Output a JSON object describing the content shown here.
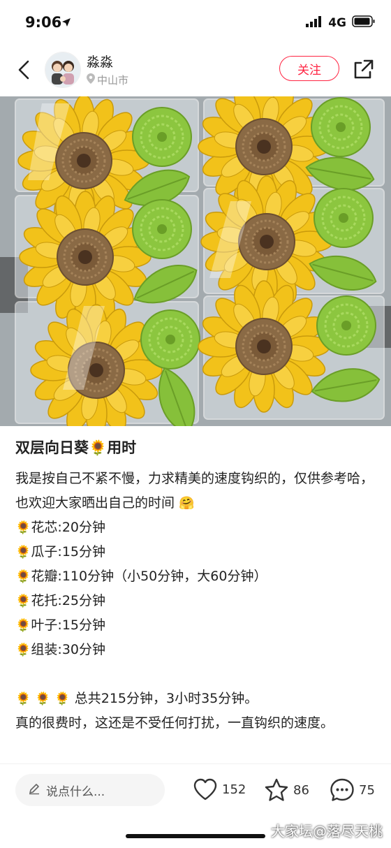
{
  "status_bar": {
    "time": "9:06",
    "network": "4G"
  },
  "header": {
    "user_name": "淼淼",
    "location": "中山市",
    "follow_label": "关注"
  },
  "post": {
    "title": "双层向日葵🌻用时",
    "intro": "我是按自己不紧不慢，力求精美的速度钩织的，仅供参考哈，也欢迎大家晒出自己的时间",
    "intro_emoji": "🤗",
    "items": [
      {
        "icon": "🌻",
        "text": "花芯:20分钟"
      },
      {
        "icon": "🌻",
        "text": "瓜子:15分钟"
      },
      {
        "icon": "🌻",
        "text": "花瓣:110分钟（小50分钟，大60分钟）"
      },
      {
        "icon": "🌻",
        "text": "花托:25分钟"
      },
      {
        "icon": "🌻",
        "text": "叶子:15分钟"
      },
      {
        "icon": "🌻",
        "text": "组装:30分钟"
      }
    ],
    "summary_icons": "🌻 🌻 🌻",
    "summary": "总共215分钟，3小时35分钟。",
    "closing": "真的很费时，这还是不受任何打扰，一直钩织的速度。"
  },
  "bottom_bar": {
    "comment_placeholder": "说点什么...",
    "likes": "152",
    "favorites": "86",
    "comments": "75"
  },
  "watermark": "大家坛@落尽天桃",
  "colors": {
    "accent": "#ff2442",
    "petal": "#f2c21a",
    "center": "#8a6a45",
    "leaf": "#8cc63f"
  }
}
